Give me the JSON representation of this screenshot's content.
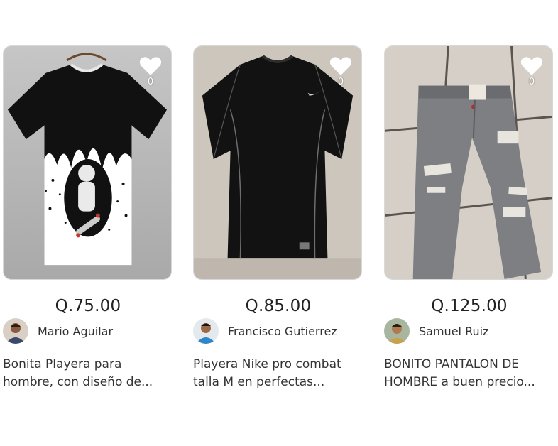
{
  "products": [
    {
      "price": "Q.75.00",
      "seller": "Mario Aguilar",
      "description": "Bonita Playera para hombre, con diseño de...",
      "likes": "0",
      "image": "astronaut-tshirt"
    },
    {
      "price": "Q.85.00",
      "seller": "Francisco Gutierrez",
      "description": "Playera Nike pro combat talla M en perfectas...",
      "likes": "0",
      "image": "black-nike-tshirt"
    },
    {
      "price": "Q.125.00",
      "seller": "Samuel Ruiz",
      "description": "BONITO PANTALON DE HOMBRE a buen precio...",
      "likes": "0",
      "image": "grey-ripped-jeans"
    }
  ],
  "icons": {
    "favorite": "heart-icon"
  },
  "colors": {
    "heart": "#ffffff",
    "price": "#222222",
    "text": "#333333"
  }
}
